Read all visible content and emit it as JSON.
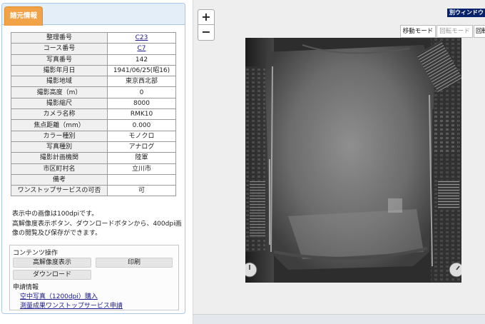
{
  "left_panel": {
    "tab_label": "諸元情報",
    "info_rows": [
      {
        "key": "整理番号",
        "value": "C23",
        "link": true
      },
      {
        "key": "コース番号",
        "value": "C7",
        "link": true
      },
      {
        "key": "写真番号",
        "value": "142",
        "link": false
      },
      {
        "key": "撮影年月日",
        "value": "1941/06/25(昭16)",
        "link": false
      },
      {
        "key": "撮影地域",
        "value": "東京西北部",
        "link": false
      },
      {
        "key": "撮影高度（m）",
        "value": "0",
        "link": false
      },
      {
        "key": "撮影縮尺",
        "value": "8000",
        "link": false
      },
      {
        "key": "カメラ名称",
        "value": "RMK10",
        "link": false
      },
      {
        "key": "焦点距離（mm）",
        "value": "0.000",
        "link": false
      },
      {
        "key": "カラー種別",
        "value": "モノクロ",
        "link": false
      },
      {
        "key": "写真種別",
        "value": "アナログ",
        "link": false
      },
      {
        "key": "撮影計画機関",
        "value": "陸軍",
        "link": false
      },
      {
        "key": "市区町村名",
        "value": "立川市",
        "link": false
      },
      {
        "key": "備考",
        "value": "",
        "link": false
      },
      {
        "key": "ワンストップサービスの可否",
        "value": "可",
        "link": false
      }
    ],
    "note_lines": [
      "表示中の画像は100dpiです。",
      "高解像度表示ボタン、ダウンロードボタンから、400dpi画",
      "像の閲覧及び保存ができます。"
    ],
    "ops": {
      "title": "コンテンツ操作",
      "high_res_button": "高解像度表示",
      "print_button": "印刷",
      "download_button": "ダウンロード",
      "apply_title": "申請情報",
      "link_purchase": "空中写真（1200dpi）購入",
      "link_onestop": "測量成果ワンストップサービス申請"
    }
  },
  "map": {
    "zoom_in": "+",
    "zoom_out": "−",
    "other_window": "別ウィンドウ",
    "modes": {
      "move": "移動モード",
      "rotate": "回転モード",
      "rotate2": "回転"
    }
  }
}
